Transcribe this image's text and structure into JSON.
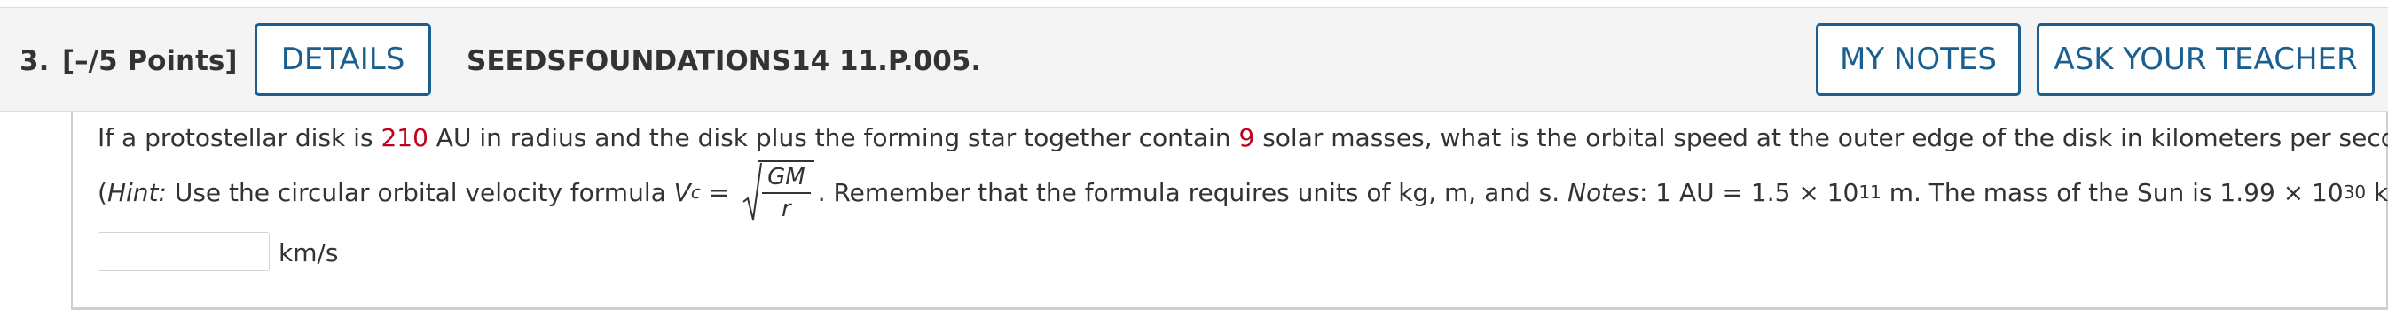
{
  "question": {
    "number": "3.",
    "points": "[–/5 Points]",
    "id": "SEEDSFOUNDATIONS14 11.P.005."
  },
  "buttons": {
    "details": "DETAILS",
    "my_notes": "MY NOTES",
    "ask_teacher": "ASK YOUR TEACHER"
  },
  "body": {
    "line1_a": "If a protostellar disk is ",
    "radius": "210",
    "line1_b": " AU in radius and the disk plus the forming star together contain ",
    "mass": "9",
    "line1_c": " solar masses, what is the orbital speed at the outer edge of the disk in kilometers per second?",
    "hint_open": "(",
    "hint_label": "Hint:",
    "hint_text": " Use the circular orbital velocity formula ",
    "v_symbol": "V",
    "v_sub": "c",
    "equals": " = ",
    "frac_num": "GM",
    "frac_den": "r",
    "after_formula": ". Remember that the formula requires units of kg, m, and s. ",
    "notes_label": "Notes",
    "notes_text_a": ": 1 AU = 1.5 × 10",
    "exp1": "11",
    "notes_text_b": " m. The mass of the Sun is 1.99 × 10",
    "exp2": "30",
    "notes_text_c": " kg.)"
  },
  "answer": {
    "value": "",
    "unit": "km/s"
  },
  "colors": {
    "accent": "#1a5f8f",
    "highlight": "#c0001c"
  }
}
